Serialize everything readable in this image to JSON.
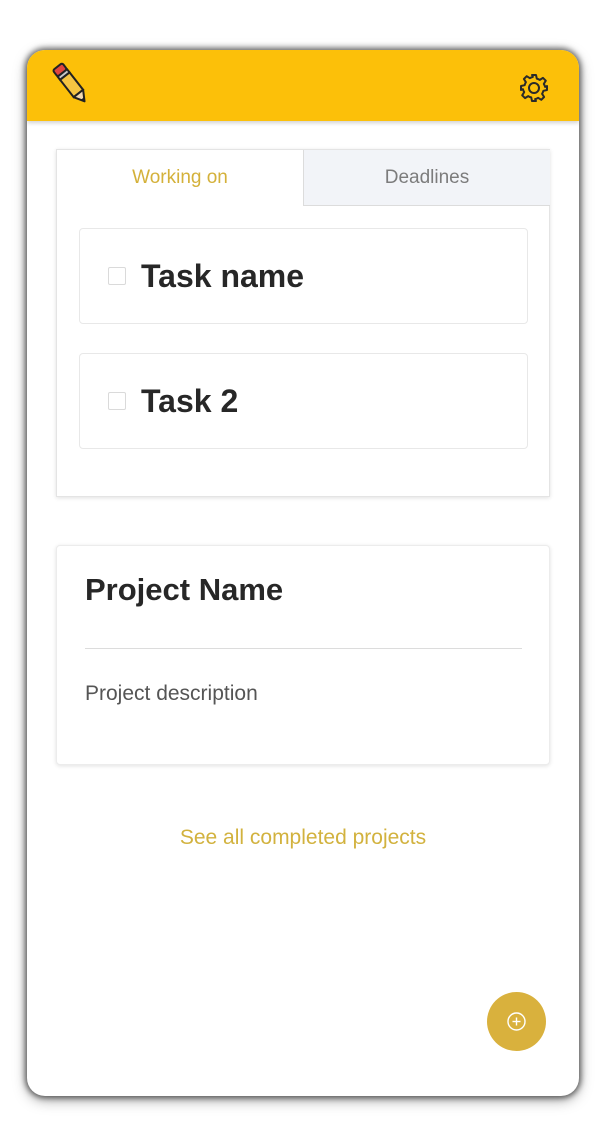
{
  "app_bar": {
    "background": "#fcc009",
    "logo_icon": "pencil-icon",
    "settings_icon": "gear-icon"
  },
  "tabs": [
    {
      "label": "Working on",
      "active": true
    },
    {
      "label": "Deadlines",
      "active": false
    }
  ],
  "tasks": [
    {
      "name": "Task name",
      "checked": false
    },
    {
      "name": "Task 2",
      "checked": false
    }
  ],
  "project": {
    "name": "Project Name",
    "description": "Project description"
  },
  "completed_link": "See all completed projects",
  "fab": {
    "icon": "plus-circle-icon",
    "color": "#d9b13d"
  },
  "colors": {
    "accent": "#d4b13a",
    "text_dark": "#272727",
    "text_muted": "#7c7c7c"
  }
}
